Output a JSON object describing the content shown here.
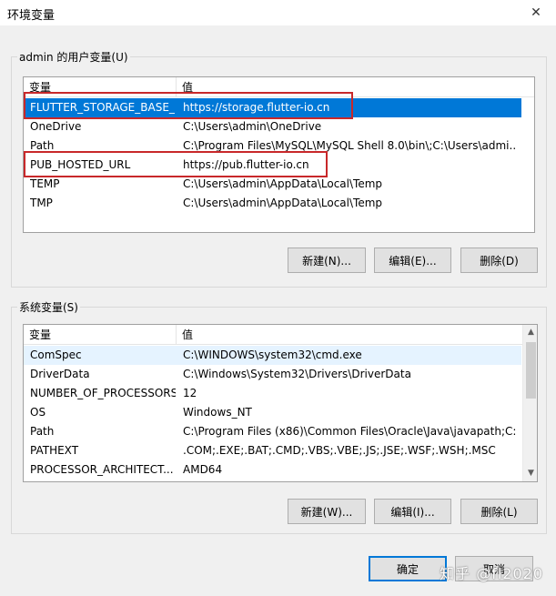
{
  "window": {
    "title": "环境变量",
    "close_glyph": "✕"
  },
  "user_vars": {
    "group_label": "admin 的用户变量(U)",
    "columns": [
      "变量",
      "值"
    ],
    "rows": [
      {
        "name": "FLUTTER_STORAGE_BASE_...",
        "value": "https://storage.flutter-io.cn",
        "selected": true
      },
      {
        "name": "OneDrive",
        "value": "C:\\Users\\admin\\OneDrive"
      },
      {
        "name": "Path",
        "value": "C:\\Program Files\\MySQL\\MySQL Shell 8.0\\bin\\;C:\\Users\\admi..."
      },
      {
        "name": "PUB_HOSTED_URL",
        "value": "https://pub.flutter-io.cn"
      },
      {
        "name": "TEMP",
        "value": "C:\\Users\\admin\\AppData\\Local\\Temp"
      },
      {
        "name": "TMP",
        "value": "C:\\Users\\admin\\AppData\\Local\\Temp"
      }
    ],
    "buttons": {
      "new": "新建(N)...",
      "edit": "编辑(E)...",
      "delete": "删除(D)"
    }
  },
  "system_vars": {
    "group_label": "系统变量(S)",
    "columns": [
      "变量",
      "值"
    ],
    "rows": [
      {
        "name": "ComSpec",
        "value": "C:\\WINDOWS\\system32\\cmd.exe",
        "hovered": true
      },
      {
        "name": "DriverData",
        "value": "C:\\Windows\\System32\\Drivers\\DriverData"
      },
      {
        "name": "NUMBER_OF_PROCESSORS",
        "value": "12"
      },
      {
        "name": "OS",
        "value": "Windows_NT"
      },
      {
        "name": "Path",
        "value": "C:\\Program Files (x86)\\Common Files\\Oracle\\Java\\javapath;C:..."
      },
      {
        "name": "PATHEXT",
        "value": ".COM;.EXE;.BAT;.CMD;.VBS;.VBE;.JS;.JSE;.WSF;.WSH;.MSC"
      },
      {
        "name": "PROCESSOR_ARCHITECT...",
        "value": "AMD64"
      }
    ],
    "buttons": {
      "new": "新建(W)...",
      "edit": "编辑(I)...",
      "delete": "删除(L)"
    }
  },
  "footer": {
    "ok": "确定",
    "cancel": "取消"
  },
  "watermark": "知乎 @fl2020",
  "colors": {
    "selection": "#0078d7",
    "hover": "#e5f3ff",
    "annotation": "#c8282a"
  }
}
